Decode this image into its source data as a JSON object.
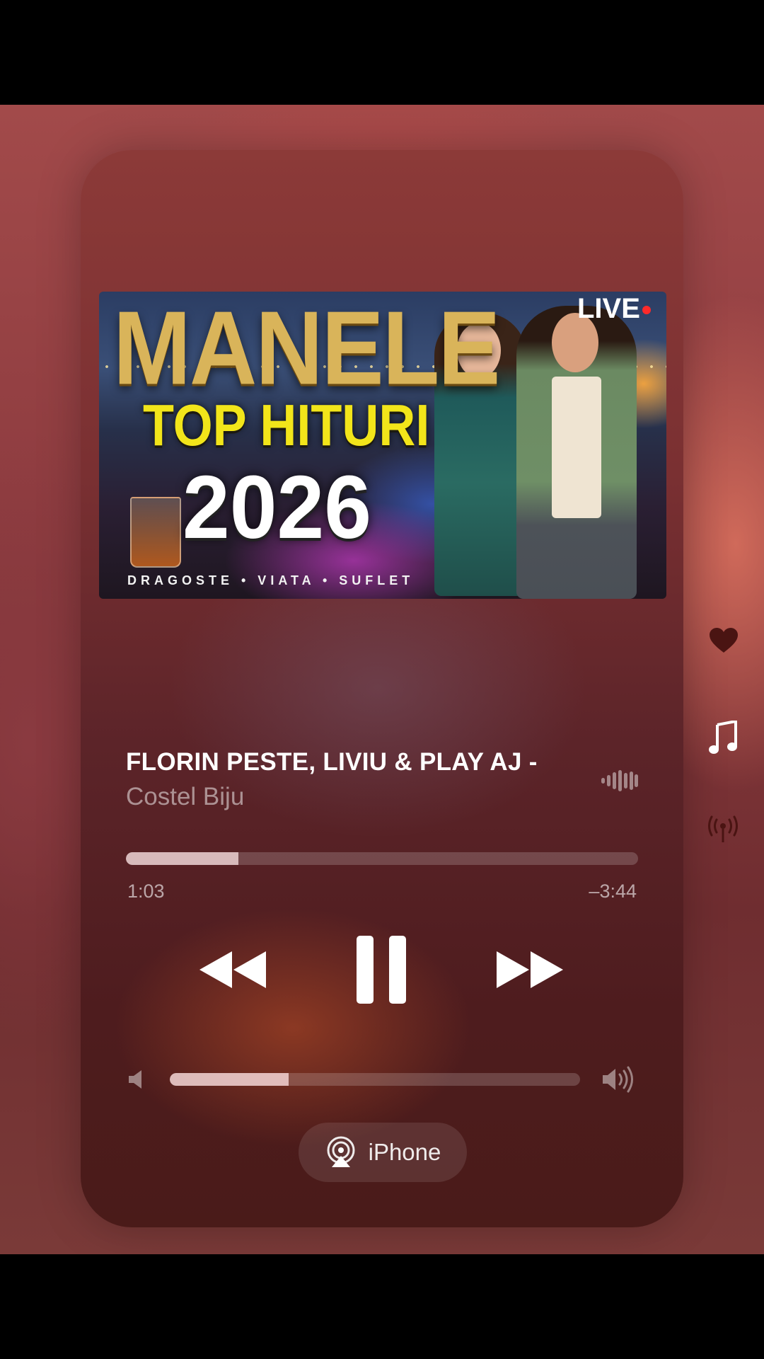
{
  "artwork": {
    "headline": "MANELE",
    "subheadline": "TOP HITURI",
    "year": "2026",
    "tagline": "DRAGOSTE • VIATA • SUFLET",
    "live_badge": "LIVE"
  },
  "track": {
    "title": "FLORIN PESTE, LIVIU & PLAY AJ -",
    "artist": "Costel Biju"
  },
  "playback": {
    "elapsed": "1:03",
    "remaining": "–3:44",
    "progress_fraction": 0.22,
    "state": "playing"
  },
  "volume": {
    "level_fraction": 0.29
  },
  "output": {
    "device_label": "iPhone",
    "icon": "airplay-icon"
  },
  "side_actions": [
    "heart-icon",
    "music-note-icon",
    "broadcast-icon"
  ],
  "colors": {
    "accent_white": "#ffffff",
    "muted_text": "rgba(255,255,255,0.5)",
    "live_dot": "#ff2a2a"
  }
}
